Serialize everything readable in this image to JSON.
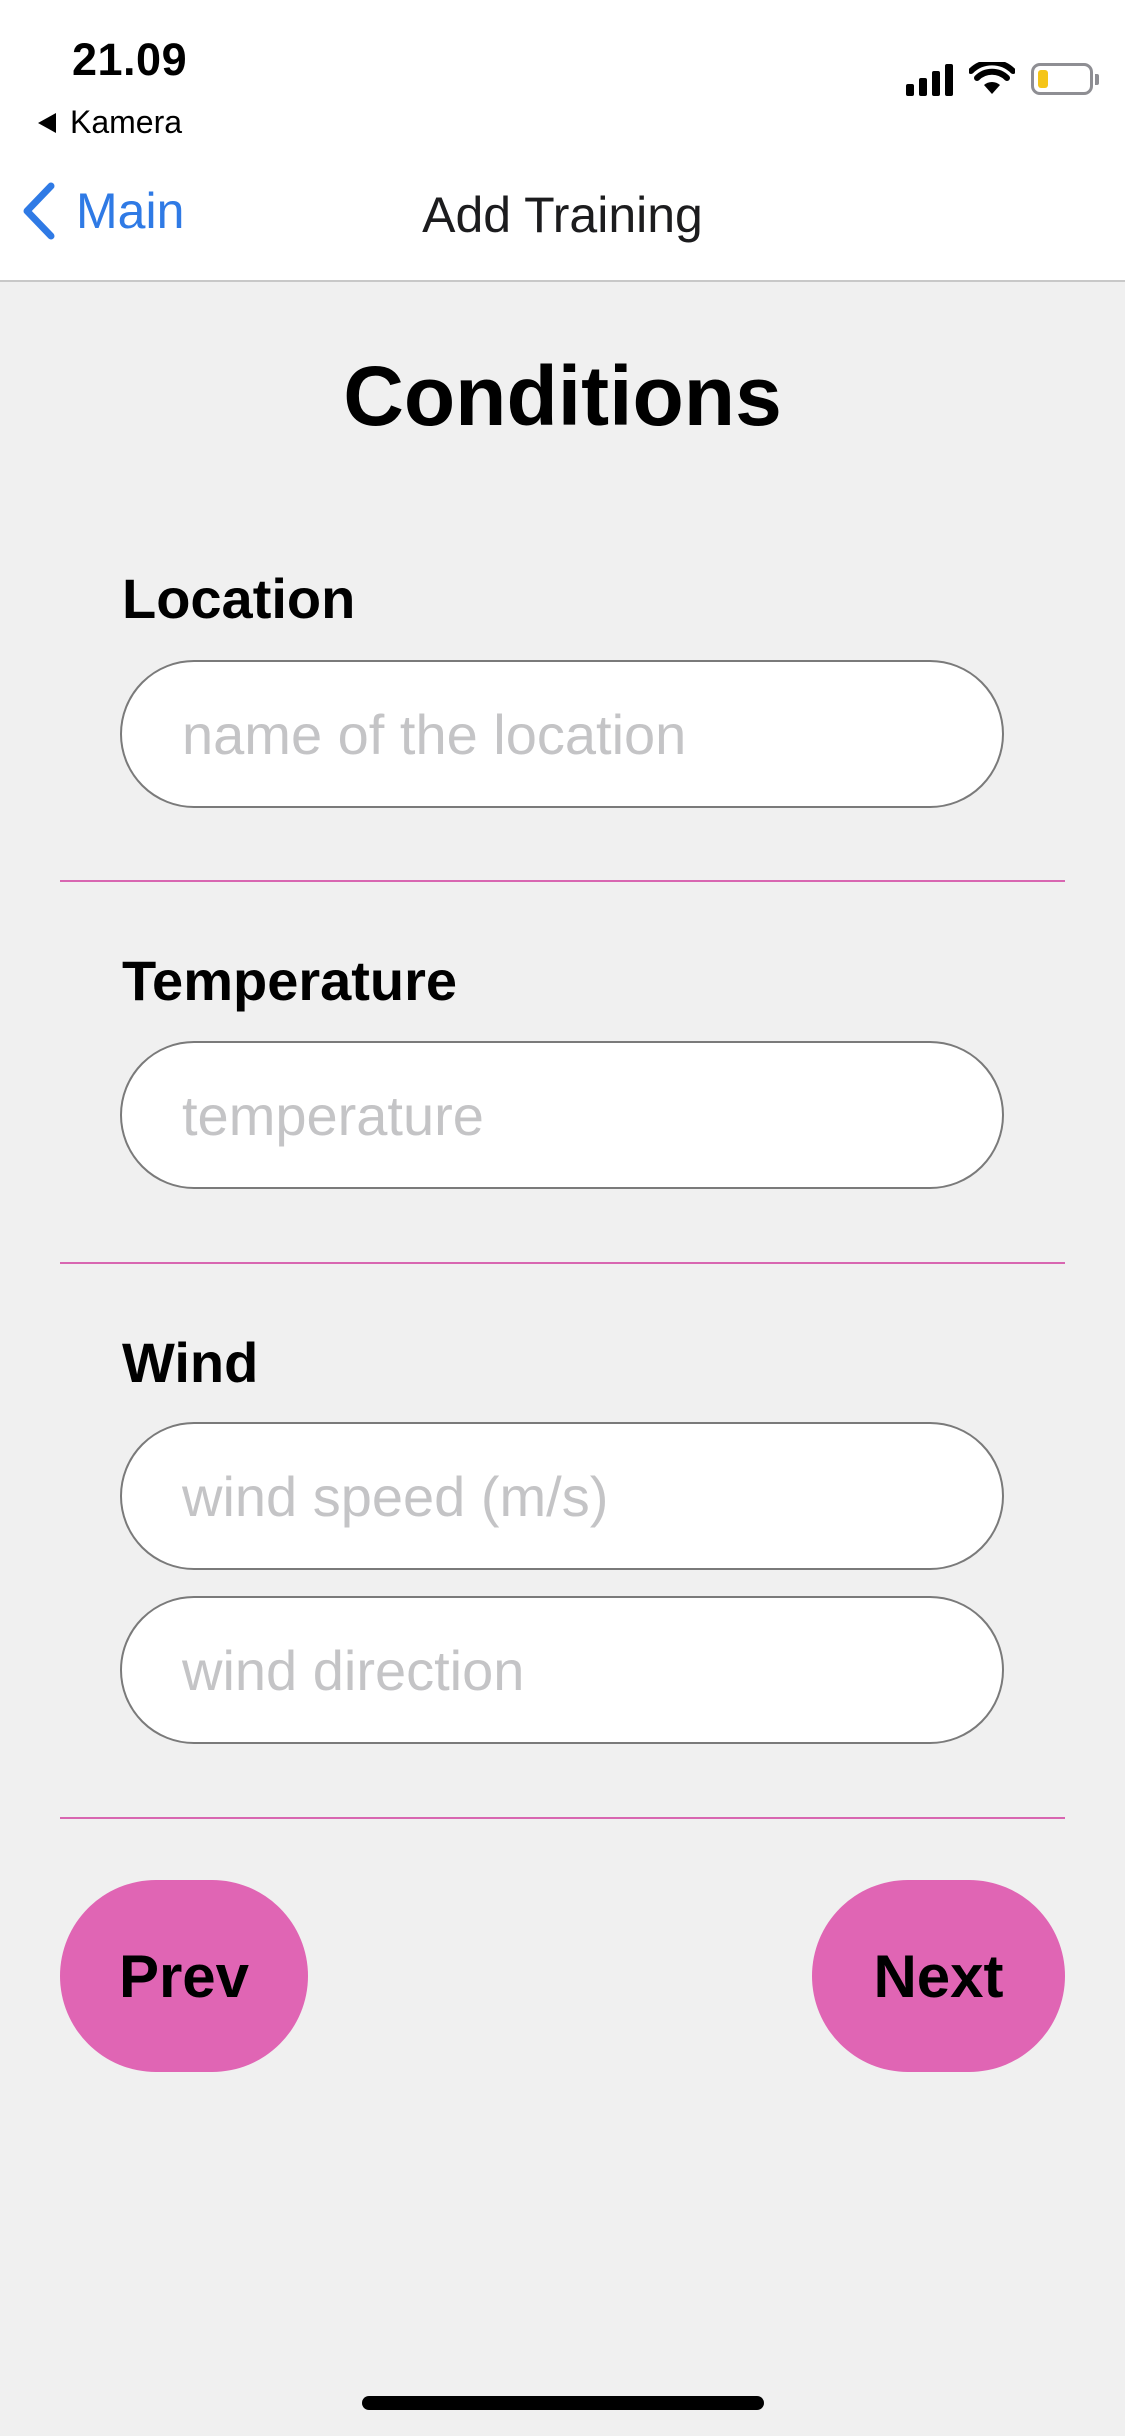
{
  "status_bar": {
    "time": "21.09",
    "back_app": "Kamera",
    "icons": [
      "signal-icon",
      "wifi-icon",
      "battery-icon"
    ],
    "battery_level": 0.2,
    "battery_color": "#f5c518"
  },
  "nav": {
    "back_label": "Main",
    "title": "Add Training",
    "accent": "#2f7ae5"
  },
  "page": {
    "heading": "Conditions"
  },
  "form": {
    "location": {
      "label": "Location",
      "placeholder": "name of the location",
      "value": ""
    },
    "temperature": {
      "label": "Temperature",
      "placeholder": "temperature",
      "value": ""
    },
    "wind": {
      "label": "Wind",
      "speed_placeholder": "wind speed (m/s)",
      "speed_value": "",
      "direction_placeholder": "wind direction",
      "direction_value": ""
    }
  },
  "buttons": {
    "prev_label": "Prev",
    "next_label": "Next",
    "color": "#e065b4"
  },
  "divider_color": "#d866b1"
}
